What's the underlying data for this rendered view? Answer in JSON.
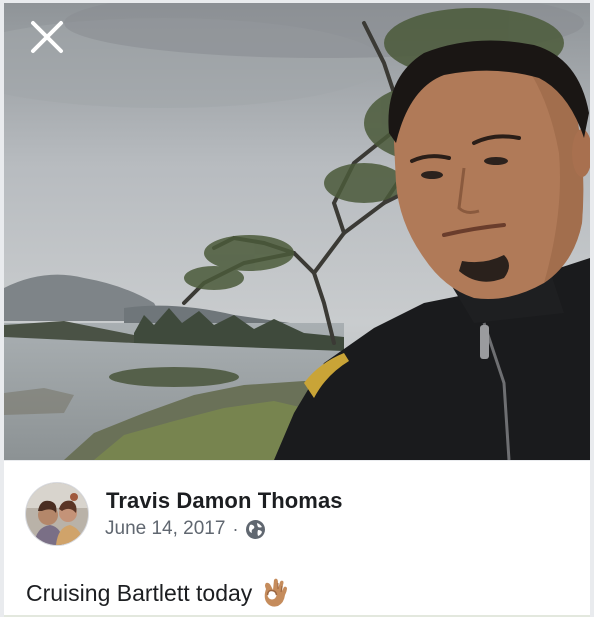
{
  "photo": {
    "alt_icon": "close-icon"
  },
  "post": {
    "author_name": "Travis Damon Thomas",
    "date": "June 14, 2017",
    "separator": "·",
    "privacy_icon": "globe-icon",
    "text": "Cruising Bartlett today",
    "emoji_icon": "ok-hand-emoji-icon"
  },
  "colors": {
    "name": "#1c1e21",
    "meta": "#606770",
    "card_bg": "#ffffff"
  }
}
